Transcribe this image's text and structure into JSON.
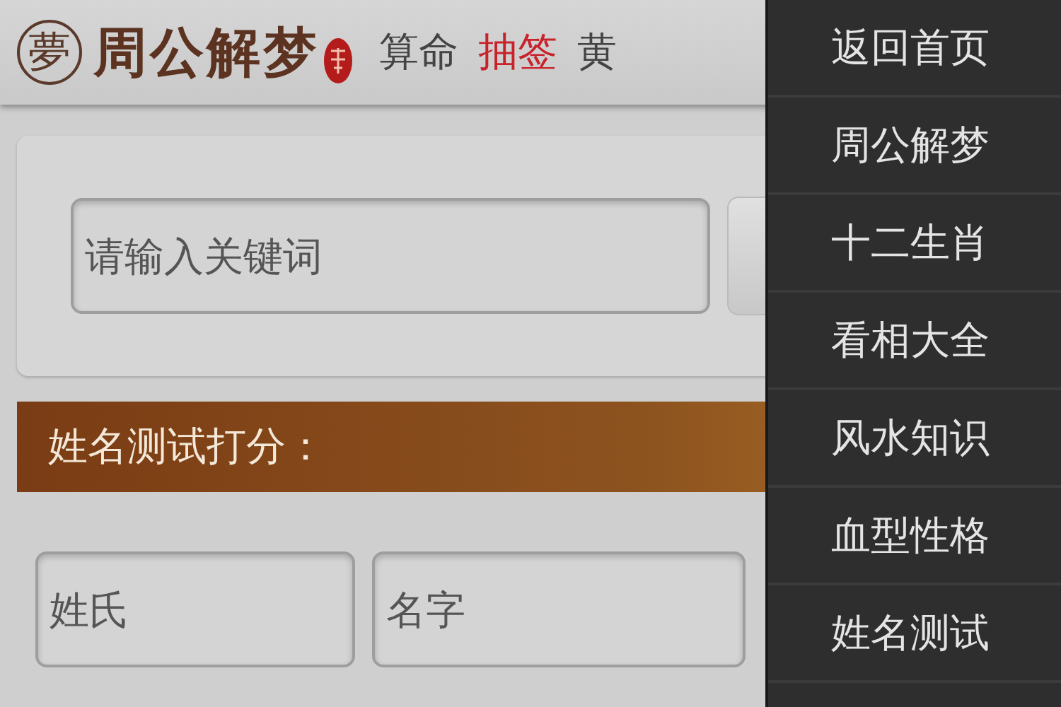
{
  "header": {
    "logo_mark": "夢",
    "logo_text": "周公解梦",
    "nav": [
      {
        "label": "算命",
        "selected": false
      },
      {
        "label": "抽签",
        "selected": true
      },
      {
        "label": "黄",
        "selected": false
      }
    ]
  },
  "search": {
    "placeholder": "请输入关键词"
  },
  "name_test": {
    "title": "姓名测试打分：",
    "fields": [
      {
        "placeholder": "姓氏"
      },
      {
        "placeholder": "名字"
      }
    ]
  },
  "menu": {
    "items": [
      "返回首页",
      "周公解梦",
      "十二生肖",
      "看相大全",
      "风水知识",
      "血型性格",
      "姓名测试"
    ]
  }
}
